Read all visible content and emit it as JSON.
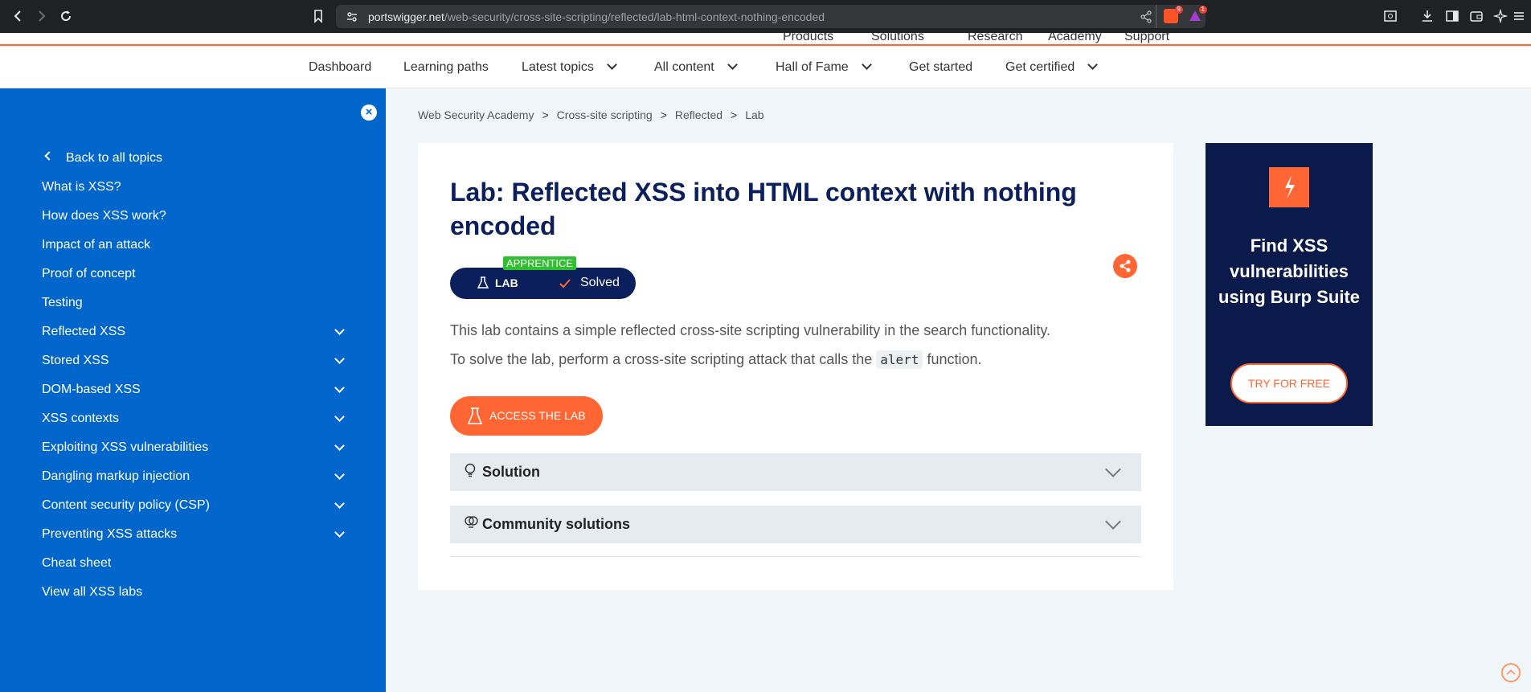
{
  "browser": {
    "url_host": "portswigger.net",
    "url_path": "/web-security/cross-site-scripting/reflected/lab-html-context-nothing-encoded",
    "brave_badge_count": "9",
    "alert_badge_count": "1"
  },
  "top_strip": {
    "items": [
      "Products",
      "Solutions",
      "Research",
      "Academy",
      "Support"
    ]
  },
  "main_nav": {
    "items": [
      "Dashboard",
      "Learning paths",
      "Latest topics",
      "All content",
      "Hall of Fame",
      "Get started",
      "Get certified"
    ]
  },
  "sidebar": {
    "back_label": "Back to all topics",
    "items": [
      "What is XSS?",
      "How does XSS work?",
      "Impact of an attack",
      "Proof of concept",
      "Testing",
      "Reflected XSS",
      "Stored XSS",
      "DOM-based XSS",
      "XSS contexts",
      "Exploiting XSS vulnerabilities",
      "Dangling markup injection",
      "Content security policy (CSP)",
      "Preventing XSS attacks",
      "Cheat sheet",
      "View all XSS labs"
    ]
  },
  "breadcrumb": {
    "items": [
      "Web Security Academy",
      "Cross-site scripting",
      "Reflected",
      "Lab"
    ],
    "separator": ">"
  },
  "lab": {
    "title": "Lab: Reflected XSS into HTML context with nothing encoded",
    "level": "APPRENTICE",
    "lab_label": "LAB",
    "status": "Solved",
    "description_1": "This lab contains a simple reflected cross-site scripting vulnerability in the search functionality.",
    "description_2_before": "To solve the lab, perform a cross-site scripting attack that calls the",
    "description_2_code": "alert",
    "description_2_after": "function.",
    "access_button": "ACCESS THE LAB",
    "solution_label": "Solution",
    "community_label": "Community solutions"
  },
  "ad": {
    "headline": "Find XSS vulnerabilities using Burp Suite",
    "button": "TRY FOR FREE"
  },
  "colors": {
    "accent": "#ff6633",
    "sidebar": "#0066cc",
    "navy": "#0a1f5c",
    "apprentice": "#2fbf2f"
  }
}
